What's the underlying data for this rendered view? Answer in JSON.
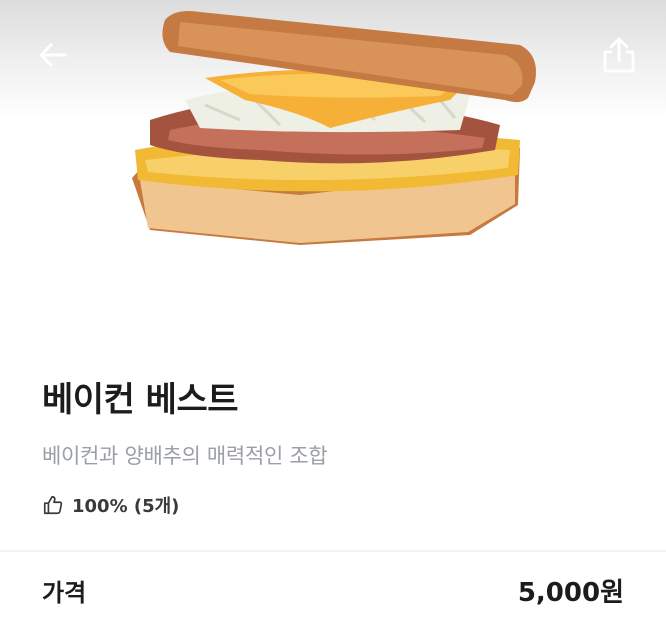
{
  "product": {
    "name": "베이컨 베스트",
    "description": "베이컨과 양배추의 매력적인 조합",
    "rating": "100% (5개)"
  },
  "price": {
    "label": "가격",
    "value": "5,000원"
  },
  "icons": {
    "back": "arrow-left-icon",
    "share": "share-icon",
    "rating": "thumbs-up-icon"
  },
  "colors": {
    "title": "#1c1c1c",
    "subtitle": "#9a9ea6",
    "divider": "#f2f3f5"
  }
}
